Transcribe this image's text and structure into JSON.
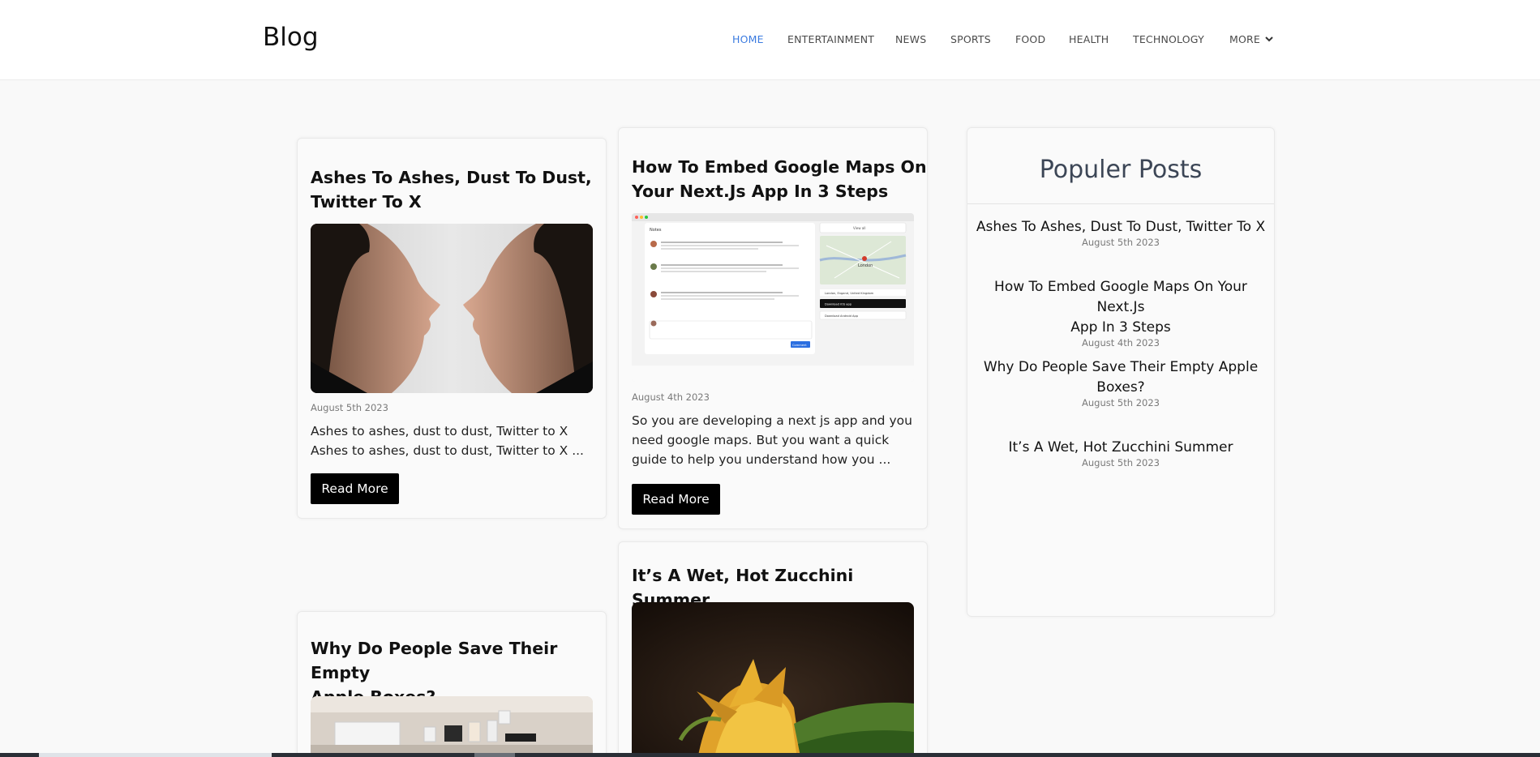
{
  "header": {
    "logo": "Blog",
    "nav": [
      {
        "label": "HOME",
        "active": true
      },
      {
        "label": "ENTERTAINMENT",
        "active": false
      },
      {
        "label": "NEWS",
        "active": false
      },
      {
        "label": "SPORTS",
        "active": false
      },
      {
        "label": "FOOD",
        "active": false
      },
      {
        "label": "HEALTH",
        "active": false
      },
      {
        "label": "TECHNOLOGY",
        "active": false
      },
      {
        "label": "MORE",
        "active": false
      }
    ],
    "accent_color": "#3b7be0"
  },
  "posts": [
    {
      "title_line1": "Ashes To Ashes, Dust To Dust,",
      "title_line2": "Twitter To X",
      "date": "August 5th 2023",
      "excerpt": "Ashes to ashes, dust to dust, Twitter to X Ashes to ashes, dust to dust, Twitter to X ...",
      "read_more": "Read More",
      "image": "two-faces-profile"
    },
    {
      "title_line1": "How To Embed Google Maps On",
      "title_line2": "Your Next.Js App In 3 Steps",
      "date": "August 4th 2023",
      "excerpt": "So you are developing a next js app and you need google maps. But you want a quick guide to help you understand how you ...",
      "read_more": "Read More",
      "image": "app-screenshot-with-map",
      "screenshot_text": {
        "panel_title": "Notes",
        "button": "View all",
        "map_label": "London",
        "location": "London, Engand, United Kingdom",
        "download_ios": "Download iOS app",
        "download_android": "Download Android App",
        "comment_button": "Comment"
      }
    },
    {
      "title_line1": "It’s A Wet, Hot Zucchini Summer",
      "image": "zucchini-flowers"
    },
    {
      "title_line1": "Why Do People Save Their Empty",
      "title_line2": "Apple Boxes?",
      "image": "apple-boxes"
    }
  ],
  "sidebar": {
    "title": "Populer Posts",
    "items": [
      {
        "title": "Ashes To Ashes, Dust To Dust, Twitter To X",
        "date": "August 5th 2023"
      },
      {
        "title_line1": "How To Embed Google Maps On Your Next.Js",
        "title_line2": "App In 3 Steps",
        "date": "August 4th 2023"
      },
      {
        "title_line1": "Why Do People Save Their Empty Apple",
        "title_line2": "Boxes?",
        "date": "August 5th 2023"
      },
      {
        "title": "It’s A Wet, Hot Zucchini Summer",
        "date": "August 5th 2023"
      }
    ]
  }
}
